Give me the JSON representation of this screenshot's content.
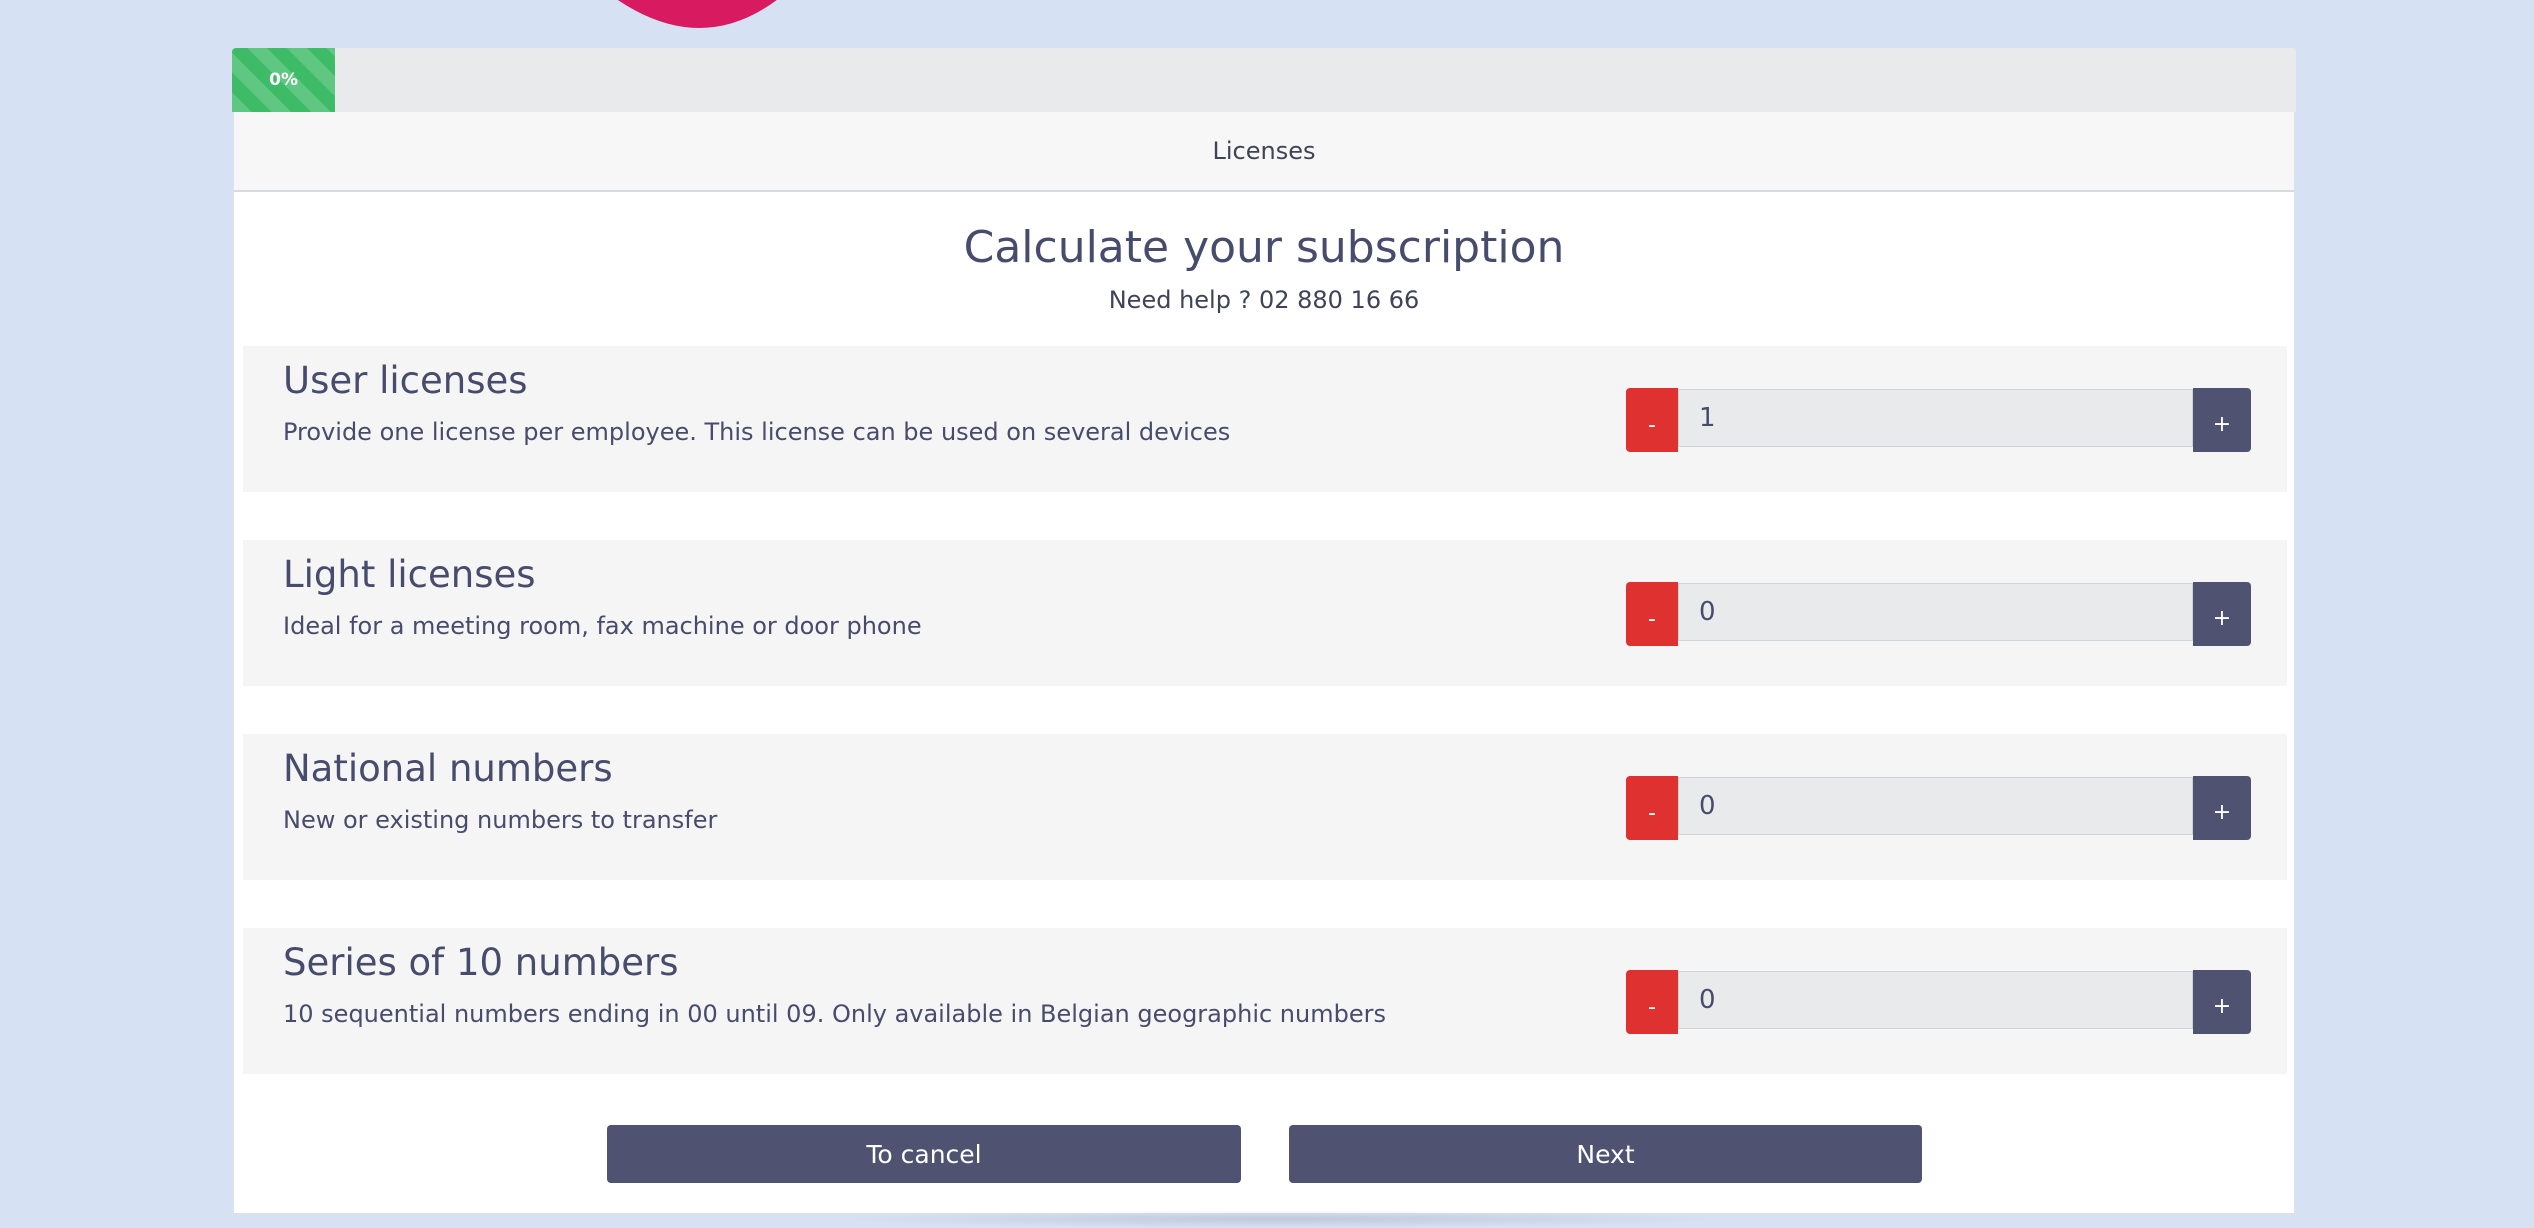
{
  "progress": {
    "value": 0.05,
    "label": "0%",
    "color": "#3dbb66"
  },
  "header": {
    "title": "Licenses"
  },
  "main": {
    "title": "Calculate your subscription",
    "help": "Need help ? 02 880 16 66",
    "rows": [
      {
        "title": "User licenses",
        "description": "Provide one license per employee. This license can be used on several devices",
        "value": "1"
      },
      {
        "title": "Light licenses",
        "description": "Ideal for a meeting room, fax machine or door phone",
        "value": "0"
      },
      {
        "title": "National numbers",
        "description": "New or existing numbers to transfer",
        "value": "0"
      },
      {
        "title": "Series of 10 numbers",
        "description": "10 sequential numbers ending in 00 until 09. Only available in Belgian geographic numbers",
        "value": "0"
      }
    ],
    "stepper": {
      "minus_label": "-",
      "plus_label": "+"
    }
  },
  "actions": {
    "cancel_label": "To cancel",
    "next_label": "Next"
  },
  "colors": {
    "background": "#d6e2f4",
    "minus": "#e03131",
    "primary": "#4f5371",
    "logo_blue": "#1f5ea8",
    "logo_pink": "#d81b60"
  },
  "icons": {
    "logo": "magic-logo"
  }
}
